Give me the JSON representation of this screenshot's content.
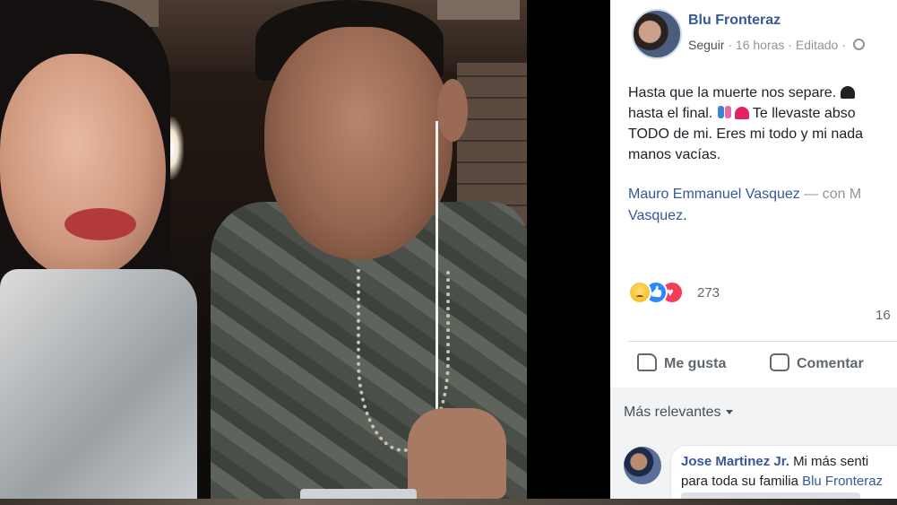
{
  "post": {
    "author": "Blu Fronteraz",
    "follow_label": "Seguir",
    "time": "16 horas",
    "edited_label": "Editado",
    "separator": "·",
    "text_lines": [
      "Hasta que la muerte nos separe.",
      "hasta el final.",
      "Te llevaste abso",
      "TODO de mi. Eres mi todo y mi nada",
      "manos vacías."
    ],
    "tag_person": "Mauro Emmanuel Vasquez",
    "tag_dash": " — con M",
    "tag_person2_end": "Vasquez",
    "tag_period": ".",
    "reaction_count": "273",
    "comment_count": "16",
    "icons": {
      "sad": "sad-reaction-icon",
      "like": "like-reaction-icon",
      "love": "love-reaction-icon",
      "globe": "globe-icon"
    }
  },
  "actions": {
    "like_label": "Me gusta",
    "comment_label": "Comentar"
  },
  "comments": {
    "sort_label": "Más relevantes",
    "items": [
      {
        "author": "Jose Martinez Jr.",
        "text_line1": "Mi más senti",
        "text_line2_pre": "para toda su familia ",
        "text_line2_link": "Blu Fronteraz"
      }
    ]
  },
  "colors": {
    "link": "#365899",
    "meta": "#90949c",
    "divider": "#dadde1"
  }
}
